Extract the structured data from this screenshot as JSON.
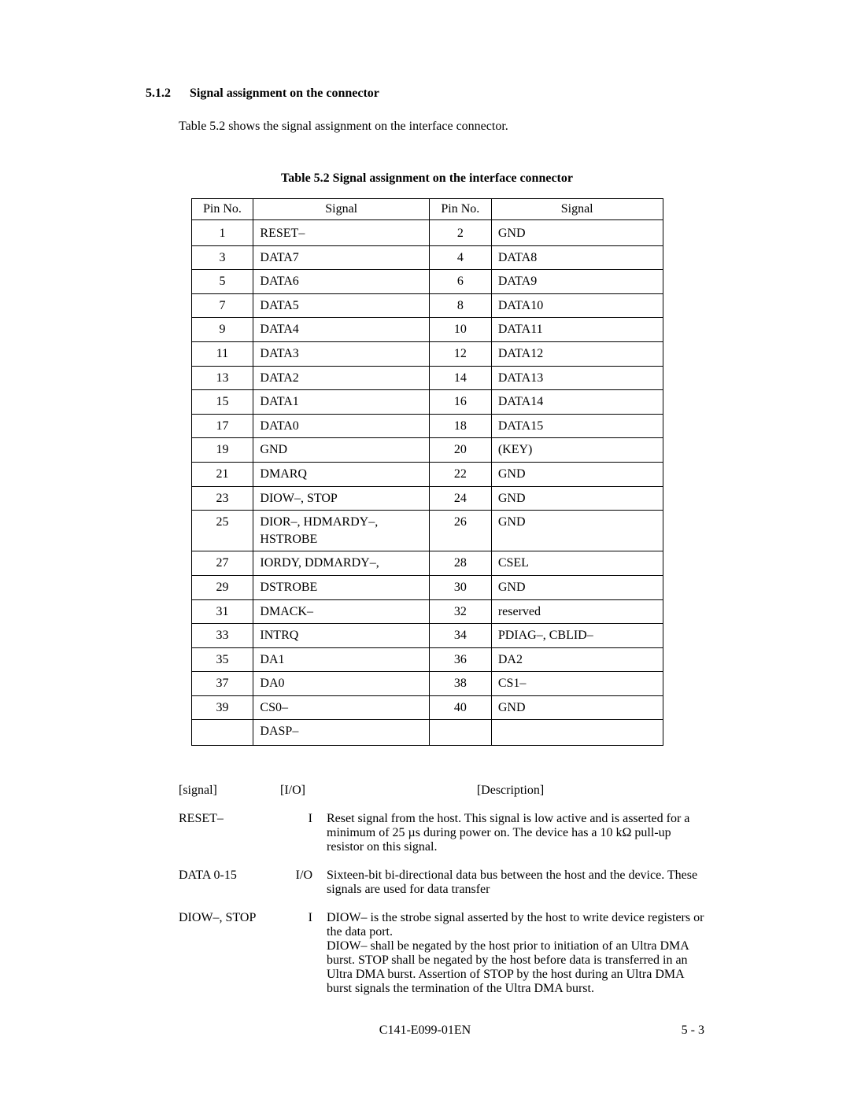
{
  "section": {
    "number": "5.1.2",
    "title": "Signal assignment on the connector",
    "intro": "Table 5.2 shows the signal assignment on the interface connector."
  },
  "table_caption": "Table 5.2    Signal assignment on the interface connector",
  "table_headers": {
    "pin": "Pin No.",
    "signal": "Signal"
  },
  "rows": [
    {
      "p1": "1",
      "s1": "RESET–",
      "p2": "2",
      "s2": "GND"
    },
    {
      "p1": "3",
      "s1": "DATA7",
      "p2": "4",
      "s2": "DATA8"
    },
    {
      "p1": "5",
      "s1": "DATA6",
      "p2": "6",
      "s2": "DATA9"
    },
    {
      "p1": "7",
      "s1": "DATA5",
      "p2": "8",
      "s2": "DATA10"
    },
    {
      "p1": "9",
      "s1": "DATA4",
      "p2": "10",
      "s2": "DATA11"
    },
    {
      "p1": "11",
      "s1": "DATA3",
      "p2": "12",
      "s2": "DATA12"
    },
    {
      "p1": "13",
      "s1": "DATA2",
      "p2": "14",
      "s2": "DATA13"
    },
    {
      "p1": "15",
      "s1": "DATA1",
      "p2": "16",
      "s2": "DATA14"
    },
    {
      "p1": "17",
      "s1": "DATA0",
      "p2": "18",
      "s2": "DATA15"
    },
    {
      "p1": "19",
      "s1": "GND",
      "p2": "20",
      "s2": "(KEY)"
    },
    {
      "p1": "21",
      "s1": "DMARQ",
      "p2": "22",
      "s2": "GND"
    },
    {
      "p1": "23",
      "s1": "DIOW–, STOP",
      "p2": "24",
      "s2": "GND"
    },
    {
      "p1": "25",
      "s1": "DIOR–, HDMARDY–, HSTROBE",
      "p2": "26",
      "s2": "GND"
    },
    {
      "p1": "27",
      "s1": "IORDY, DDMARDY–,",
      "p2": "28",
      "s2": "CSEL"
    },
    {
      "p1": "29",
      "s1": "DSTROBE",
      "p2": "30",
      "s2": "GND"
    },
    {
      "p1": "31",
      "s1": "DMACK–",
      "p2": "32",
      "s2": "reserved"
    },
    {
      "p1": "33",
      "s1": "INTRQ",
      "p2": "34",
      "s2": "PDIAG–, CBLID–"
    },
    {
      "p1": "35",
      "s1": "DA1",
      "p2": "36",
      "s2": "DA2"
    },
    {
      "p1": "37",
      "s1": "DA0",
      "p2": "38",
      "s2": "CS1–"
    },
    {
      "p1": "39",
      "s1": "CS0–",
      "p2": "40",
      "s2": "GND"
    },
    {
      "p1": "",
      "s1": "DASP–",
      "p2": "",
      "s2": ""
    }
  ],
  "desc_headers": {
    "signal": "[signal]",
    "io": "[I/O]",
    "description": "[Description]"
  },
  "descriptions": [
    {
      "signal": "RESET–",
      "io": "I",
      "text": "Reset signal from the host.  This signal is low active and is asserted for a minimum of 25 µs during power on.  The device has a 10 kΩ pull-up resistor on this signal."
    },
    {
      "signal": "DATA 0-15",
      "io": "I/O",
      "text": "Sixteen-bit bi-directional data bus between the host and the device. These signals are used for data transfer"
    },
    {
      "signal": "DIOW–, STOP",
      "io": "I",
      "text": "DIOW– is the strobe signal asserted by the host to write device registers or the data port.\nDIOW– shall be negated by the host prior to initiation of an Ultra DMA burst.  STOP shall be negated by the host before data is transferred in an Ultra DMA burst.  Assertion of STOP by the host during an Ultra DMA burst signals the termination of the Ultra DMA burst."
    }
  ],
  "footer": {
    "doc": "C141-E099-01EN",
    "page": "5 - 3"
  }
}
